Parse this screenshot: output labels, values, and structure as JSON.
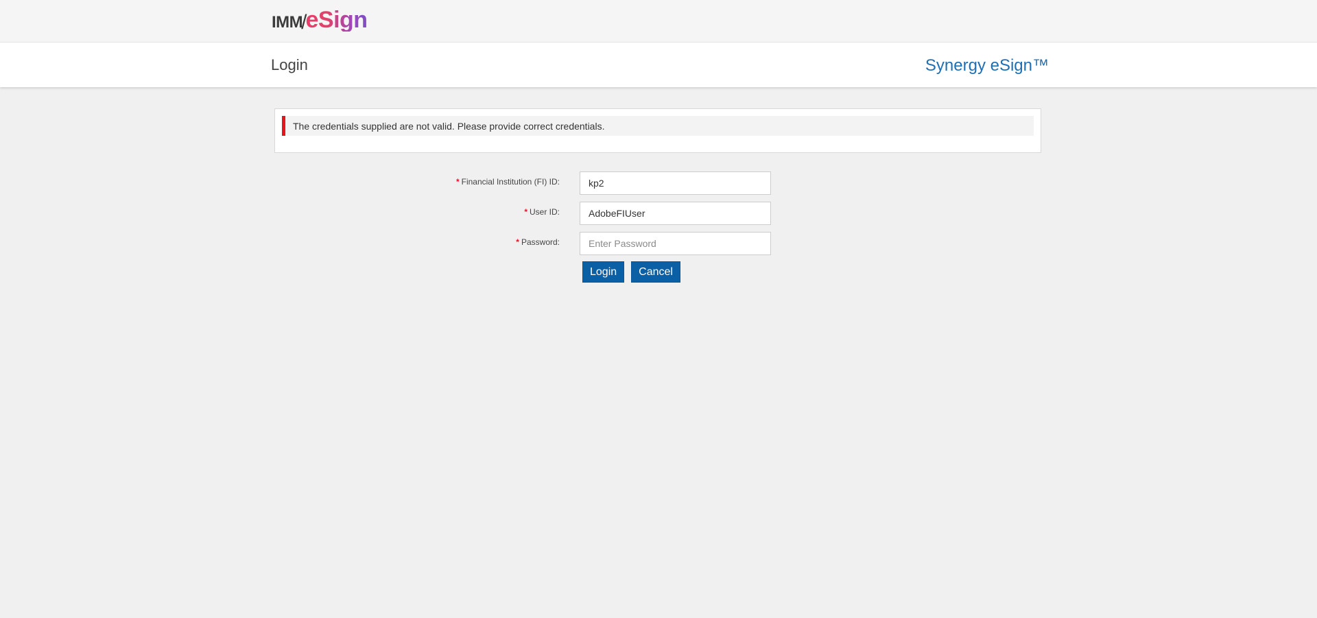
{
  "topbar": {
    "logo_left": "IMM",
    "logo_slash": "/",
    "logo_right": "eSign"
  },
  "header": {
    "title": "Login",
    "product": "Synergy eSign™"
  },
  "alert": {
    "message": "The credentials supplied are not valid. Please provide correct credentials.",
    "accent_color": "#e8141d"
  },
  "form": {
    "required_marker": "*",
    "fi_id": {
      "label": "Financial Institution (FI) ID:",
      "value": "kp2",
      "placeholder": ""
    },
    "user_id": {
      "label": "User ID:",
      "value": "AdobeFIUser",
      "placeholder": ""
    },
    "password": {
      "label": "Password:",
      "value": "",
      "placeholder": "Enter Password"
    },
    "login_label": "Login",
    "cancel_label": "Cancel"
  },
  "colors": {
    "brand_blue": "#0b5fa5",
    "product_blue": "#1f6fb5",
    "logo_pink": "#e83e6c",
    "logo_purple": "#7a4fc4"
  }
}
